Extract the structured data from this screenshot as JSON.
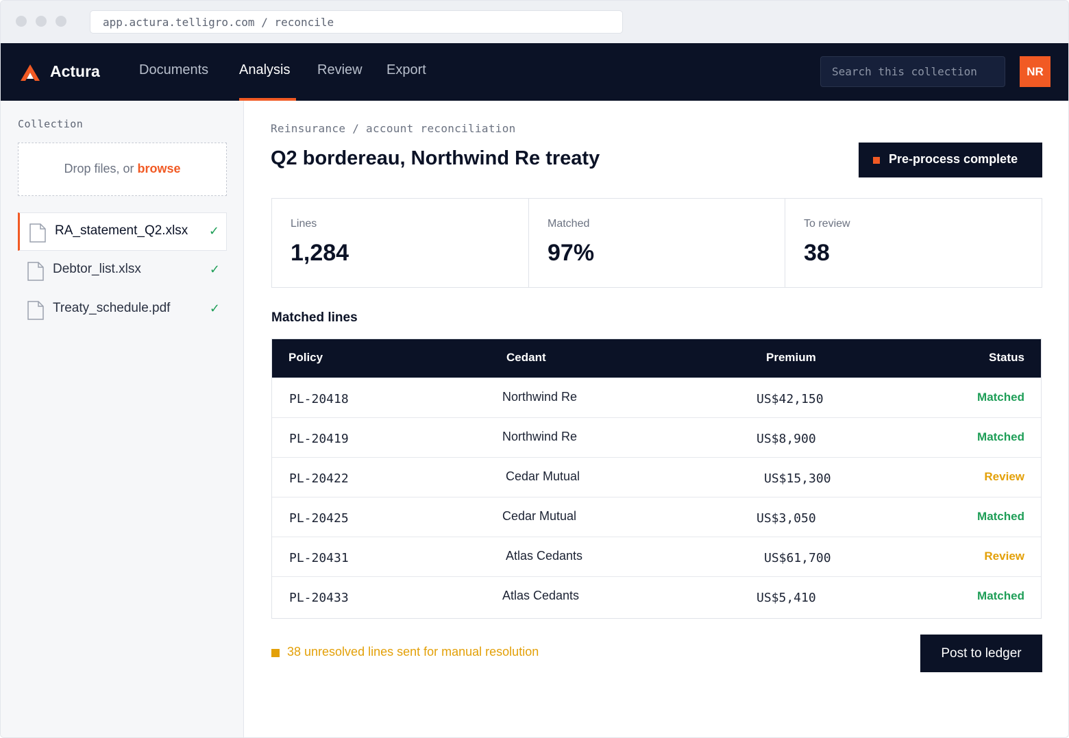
{
  "browser": {
    "url": "app.actura.telligro.com / reconcile"
  },
  "nav": {
    "brand": "Actura",
    "tabs": [
      {
        "label": "Documents"
      },
      {
        "label": "Analysis"
      },
      {
        "label": "Review"
      },
      {
        "label": "Export"
      }
    ],
    "active_tab": "Analysis",
    "search_placeholder": "Search this collection",
    "avatar_initials": "NR"
  },
  "sidebar": {
    "title": "Collection",
    "dropzone": {
      "text": "Drop files, or ",
      "link": "browse"
    },
    "files": [
      {
        "name": "RA_statement_Q2.xlsx",
        "check": "✓"
      },
      {
        "name": "Debtor_list.xlsx",
        "check": "✓"
      },
      {
        "name": "Treaty_schedule.pdf",
        "check": "✓"
      }
    ]
  },
  "main": {
    "breadcrumb": "Reinsurance / account reconciliation",
    "title": "Q2 bordereau, Northwind Re treaty",
    "status_pill": "Pre-process complete",
    "stats": [
      {
        "label": "Lines",
        "value": "1,284"
      },
      {
        "label": "Matched",
        "value": "97%"
      },
      {
        "label": "To review",
        "value": "38"
      }
    ],
    "section_title": "Matched lines",
    "table": {
      "headers": {
        "policy": "Policy",
        "cedant": "Cedant",
        "premium": "Premium",
        "status": "Status"
      },
      "rows": [
        {
          "policy": "PL-20418",
          "cedant": "Northwind Re",
          "premium": "US$42,150",
          "status": "Matched"
        },
        {
          "policy": "PL-20419",
          "cedant": "Northwind Re",
          "premium": "US$8,900",
          "status": "Matched"
        },
        {
          "policy": "PL-20422",
          "cedant": "Cedar Mutual",
          "premium": "US$15,300",
          "status": "Review"
        },
        {
          "policy": "PL-20425",
          "cedant": "Cedar Mutual",
          "premium": "US$3,050",
          "status": "Matched"
        },
        {
          "policy": "PL-20431",
          "cedant": "Atlas Cedants",
          "premium": "US$61,700",
          "status": "Review"
        },
        {
          "policy": "PL-20433",
          "cedant": "Atlas Cedants",
          "premium": "US$5,410",
          "status": "Matched"
        }
      ]
    },
    "footer_note": "38 unresolved lines sent for manual resolution",
    "post_button": "Post to ledger"
  },
  "colors": {
    "accent": "#f15a24",
    "navy": "#0b1226",
    "matched": "#1e9e57",
    "review": "#e3a008"
  }
}
